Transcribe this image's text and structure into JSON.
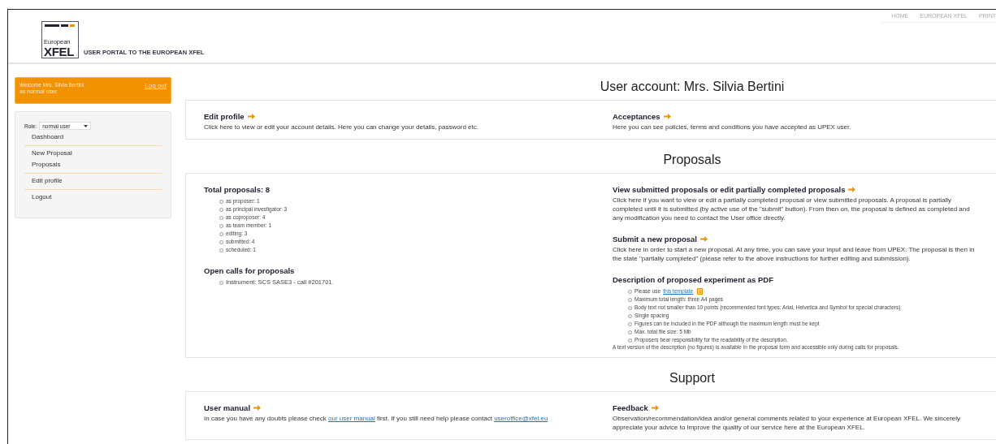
{
  "header": {
    "logo_top": "European",
    "logo_main": "XFEL",
    "tagline": "USER PORTAL TO THE EUROPEAN XFEL",
    "top_links": [
      "HOME",
      "EUROPEAN XFEL",
      "PRINT"
    ]
  },
  "welcome": {
    "text": "Welcome Mrs. Silvia Bertini.",
    "subtext": "as normal user",
    "logout": "Log out"
  },
  "sidebar": {
    "role_label": "Role:",
    "role_value": "normal user",
    "groups": [
      [
        "Dashboard"
      ],
      [
        "New Proposal",
        "Proposals"
      ],
      [
        "Edit profile"
      ],
      [
        "Logout"
      ]
    ]
  },
  "sections": [
    {
      "title": "User account: Mrs. Silvia Bertini",
      "columns": [
        [
          {
            "kind": "link_block",
            "title": "Edit profile",
            "lines": [
              "Click here to view or edit your account details. Here you can change your details, password etc."
            ]
          }
        ],
        [
          {
            "kind": "link_block",
            "title": "Acceptances",
            "lines": [
              "Here you can see policies, terms and conditions you have accepted as UPEX user."
            ]
          }
        ]
      ]
    },
    {
      "title": "Proposals",
      "columns": [
        [
          {
            "kind": "list_block",
            "title": "Total proposals: 8",
            "items": [
              "as proposer: 1",
              "as principal investigator: 3",
              "as coproposer: 4",
              "as team member: 1",
              "editing: 3",
              "submitted: 4",
              "scheduled: 1"
            ]
          },
          {
            "kind": "list_block",
            "title": "Open calls for proposals",
            "items": [
              "Instrument: SCS SASE3 - call #201701."
            ]
          }
        ],
        [
          {
            "kind": "link_block",
            "title": "View submitted proposals or edit partially completed proposals",
            "lines": [
              "Click here if you want to view or edit a partially completed proposal or view submitted proposals. A proposal is partially",
              "completed until it is submitted (by active use of the \"submit\" button). From then on, the proposal is defined as completed and",
              "any modification you need to contact the User office directly."
            ]
          },
          {
            "kind": "link_block",
            "title": "Submit a new proposal",
            "lines": [
              "Click here in order to start a new proposal. At any time, you can save your input and leave from UPEX. The proposal is then in",
              "the state \"partially completed\" (please refer to the above instructions for further editing and submission)."
            ]
          },
          {
            "kind": "pdf_block",
            "title": "Description of proposed experiment as PDF",
            "lead": "Please use",
            "link": "this template",
            "items": [
              "Maximum total length: three A4 pages",
              "Body text not smaller than 10 points (recommended font types: Arial, Helvetica and Symbol for special characters)",
              "Single spacing",
              "Figures can be included in the PDF although the maximum length must be kept",
              "Max. total file size: 5 Mb",
              "Proposers bear responsibility for the readability of the description."
            ],
            "note": "A text version of the description (no figures) is available in the proposal form and accessible only during calls for proposals."
          }
        ]
      ]
    },
    {
      "title": "Support",
      "columns": [
        [
          {
            "kind": "rich_block",
            "title": "User manual",
            "parts": [
              {
                "text": "In case you have any doubts please check "
              },
              {
                "link": "our user manual"
              },
              {
                "text": " first. If you still need help please contact "
              },
              {
                "link": "useroffice@xfel.eu"
              }
            ]
          }
        ],
        [
          {
            "kind": "link_block",
            "title": "Feedback",
            "lines": [
              "Observation/recommendation/idea and/or general comments related to your experience at European XFEL. We sincerely",
              "appreciate your advice to improve the quality of our service here at the European XFEL."
            ]
          }
        ]
      ]
    }
  ]
}
